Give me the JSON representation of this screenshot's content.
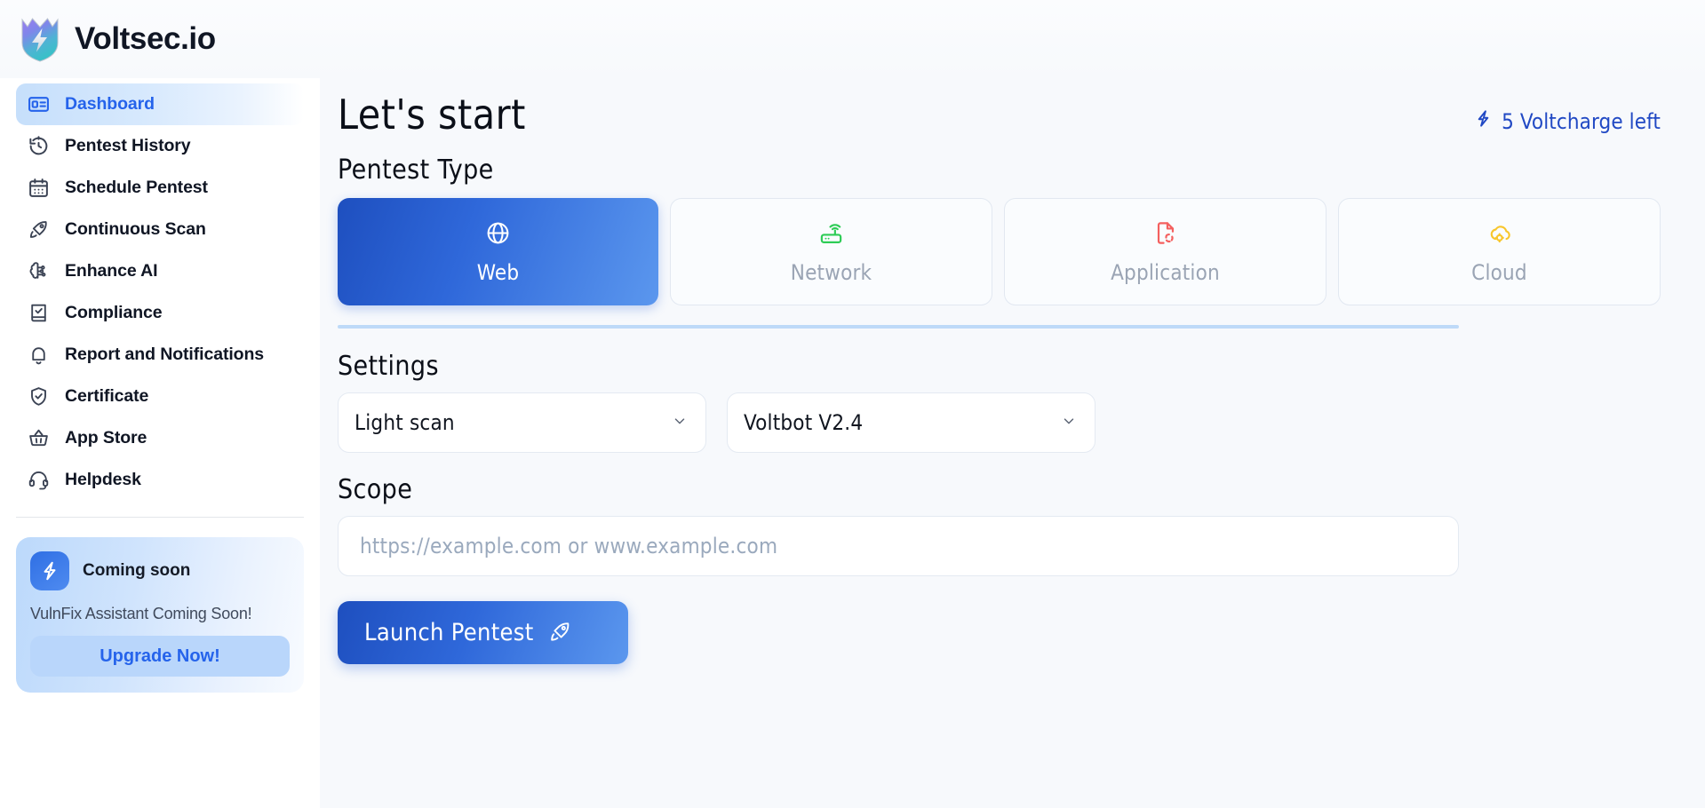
{
  "brand": {
    "name": "Voltsec.io",
    "logo_icon": "shield-bolt-logo"
  },
  "sidebar": {
    "items": [
      {
        "label": "Dashboard",
        "icon": "id-card-icon",
        "active": true
      },
      {
        "label": "Pentest History",
        "icon": "history-clock-icon",
        "active": false
      },
      {
        "label": "Schedule Pentest",
        "icon": "calendar-icon",
        "active": false
      },
      {
        "label": "Continuous Scan",
        "icon": "rocket-icon",
        "active": false
      },
      {
        "label": "Enhance AI",
        "icon": "brain-circuit-icon",
        "active": false
      },
      {
        "label": "Compliance",
        "icon": "book-check-icon",
        "active": false
      },
      {
        "label": "Report and Notifications",
        "icon": "bell-icon",
        "active": false
      },
      {
        "label": "Certificate",
        "icon": "shield-check-icon",
        "active": false
      },
      {
        "label": "App Store",
        "icon": "basket-icon",
        "active": false
      },
      {
        "label": "Helpdesk",
        "icon": "headset-icon",
        "active": false
      }
    ],
    "promo": {
      "badge_icon": "bolt-icon",
      "title": "Coming soon",
      "subtitle": "VulnFix Assistant Coming Soon!",
      "button_label": "Upgrade Now!"
    }
  },
  "main": {
    "page_title": "Let's start",
    "credits": {
      "icon": "bolt-icon",
      "label": "5 Voltcharge left"
    },
    "pentest_type": {
      "heading": "Pentest Type",
      "options": [
        {
          "label": "Web",
          "icon": "globe-icon",
          "selected": true,
          "color": "#ffffff"
        },
        {
          "label": "Network",
          "icon": "router-wifi-icon",
          "selected": false,
          "color": "#2ecc56"
        },
        {
          "label": "Application",
          "icon": "file-scan-icon",
          "selected": false,
          "color": "#f4605f"
        },
        {
          "label": "Cloud",
          "icon": "cloud-cog-icon",
          "selected": false,
          "color": "#f8c62c"
        }
      ]
    },
    "settings": {
      "heading": "Settings",
      "selects": [
        {
          "name": "scan-depth",
          "value": "Light scan",
          "chevron": "chevron-down-icon"
        },
        {
          "name": "bot-version",
          "value": "Voltbot V2.4",
          "chevron": "chevron-down-icon"
        }
      ]
    },
    "scope": {
      "heading": "Scope",
      "value": "",
      "placeholder": "https://example.com or www.example.com"
    },
    "launch_button": {
      "label": "Launch Pentest",
      "icon": "rocket-icon"
    }
  },
  "colors": {
    "accent_blue": "#2563eb",
    "deep_blue": "#2149c4",
    "page_bg": "#f7f9fc",
    "sidebar_bg": "#ffffff",
    "divider_blue": "#bedaf8",
    "muted_text": "#9aa4b4"
  }
}
